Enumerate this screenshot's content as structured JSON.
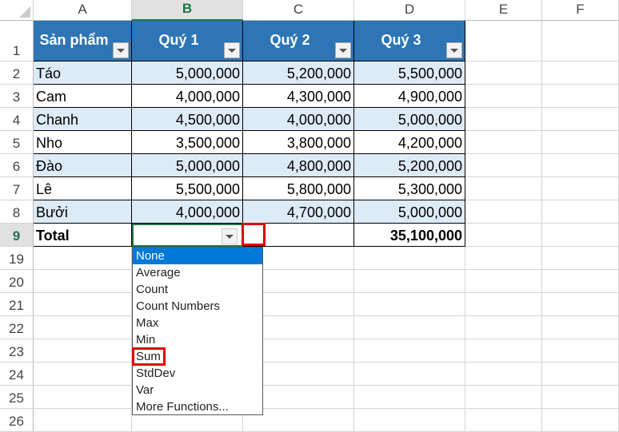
{
  "columns": [
    "A",
    "B",
    "C",
    "D",
    "E",
    "F"
  ],
  "selected_column": "B",
  "headers": [
    "Sản phẩm",
    "Quý 1",
    "Quý 2",
    "Quý 3"
  ],
  "rows": [
    {
      "row": "2",
      "cells": [
        "Táo",
        "5,000,000",
        "5,200,000",
        "5,500,000"
      ]
    },
    {
      "row": "3",
      "cells": [
        "Cam",
        "4,000,000",
        "4,300,000",
        "4,900,000"
      ]
    },
    {
      "row": "4",
      "cells": [
        "Chanh",
        "4,500,000",
        "4,000,000",
        "5,000,000"
      ]
    },
    {
      "row": "5",
      "cells": [
        "Nho",
        "3,500,000",
        "3,800,000",
        "4,200,000"
      ]
    },
    {
      "row": "6",
      "cells": [
        "Đào",
        "5,000,000",
        "4,800,000",
        "5,200,000"
      ]
    },
    {
      "row": "7",
      "cells": [
        "Lê",
        "5,500,000",
        "5,800,000",
        "5,300,000"
      ]
    },
    {
      "row": "8",
      "cells": [
        "Bưởi",
        "4,000,000",
        "4,700,000",
        "5,000,000"
      ]
    }
  ],
  "total_row": {
    "row": "9",
    "label": "Total",
    "cells": [
      "",
      "",
      "35,100,000"
    ]
  },
  "header_row": "1",
  "extra_rows": [
    "19",
    "20",
    "21",
    "22",
    "23",
    "24",
    "25",
    "26"
  ],
  "dropdown": {
    "items": [
      "None",
      "Average",
      "Count",
      "Count Numbers",
      "Max",
      "Min",
      "Sum",
      "StdDev",
      "Var",
      "More Functions..."
    ],
    "highlighted": "None",
    "marked": "Sum"
  },
  "colors": {
    "header": "#2e75b6",
    "band": "#ddebf7",
    "highlight": "#0078d7",
    "marker": "#e00000"
  }
}
